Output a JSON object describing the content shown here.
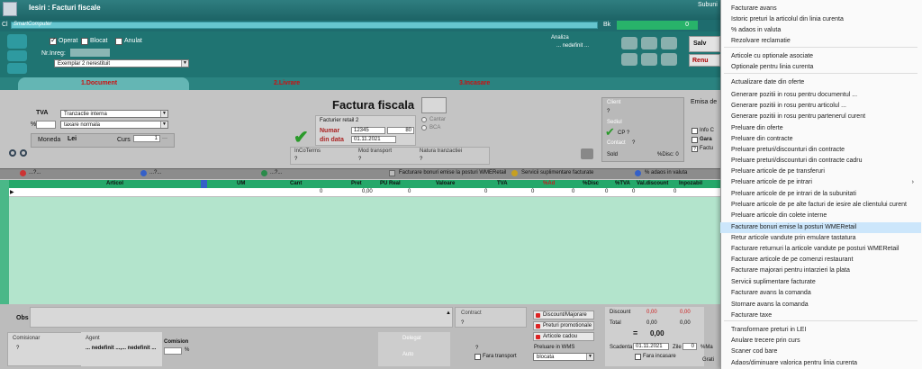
{
  "window": {
    "title": "Iesiri : Facturi fiscale",
    "right_label": "Subuni"
  },
  "top": {
    "client_label": "Cl",
    "client_value": "SmartComputer",
    "bk_label": "Bk",
    "green_value": "0"
  },
  "header": {
    "operat": "Operat",
    "blocat": "Blocat",
    "anulat": "Anulat",
    "nr_inreg_label": "Nr.Inreg:",
    "exemplar": "Exemplar 2 nerestituit",
    "analiza_label": "Analiza",
    "analiza_value": "... nedefinit ...",
    "salveaza": "Salv",
    "renunta": "Renu"
  },
  "tabs": [
    {
      "label": "1.Document"
    },
    {
      "label": "2.Livrare"
    },
    {
      "label": "3.Incasare"
    }
  ],
  "doc": {
    "tva_label": "TVA",
    "tva_value": "Tranzactie interna",
    "tva_pct_label": "%",
    "taxare": "taxare normala",
    "moneda_label": "Moneda",
    "moneda_value": "Lei",
    "curs_label": "Curs",
    "curs_value": "1",
    "factura_title": "Factura fiscala",
    "facturier": "Facturier retail 2",
    "numar_label": "Numar",
    "numar_value": "12345",
    "numar_right": "80",
    "data_label": "din data",
    "data_value": "01.11.2021",
    "cantar": "Cantar",
    "bca": "BCA",
    "incoterms_label": "InCoTerms",
    "incoterms_value": "?",
    "mod_transport_label": "Mod transport",
    "mod_transport_value": "?",
    "natura_label": "Natura tranzactiei",
    "natura_value": "?",
    "client_label": "Client",
    "client_value": "?",
    "sediu_label": "Sediul",
    "sediu_value": "CP ?",
    "contact_label": "Contact",
    "contact_value": "?",
    "sold_label": "Sold",
    "disc_label": "%Disc: 0",
    "emisa_label": "Emisa de",
    "info_label": "Info C",
    "gara_label": "Gara",
    "factu_label": "Factu"
  },
  "iconbar": [
    "...?...",
    "...?...",
    "...?...",
    "Facturare bonuri emise la posturi WMERetail",
    "Servicii suplimentare facturate",
    "% adaos in valuta"
  ],
  "grid": {
    "headers": [
      "Articol",
      "UM",
      "Cant",
      "Pret",
      "PU Real",
      "Valoare",
      "TVA",
      "%Ad",
      "%Disc",
      "%TVA",
      "Val.discount",
      "Inpozabil"
    ],
    "row": {
      "cant": "0",
      "pret": "0,00",
      "pu_real": "0",
      "valoare": "0",
      "tva": "0",
      "ad": "0",
      "disc": "0",
      "tva_pct": "0",
      "valdisc": "0"
    }
  },
  "bottom": {
    "obs_label": "Obs",
    "contract_label": "Contract",
    "contract_value": "?",
    "btn_discount": "Discount/Majorare",
    "btn_preturi": "Preturi promotionale",
    "btn_cadou": "Articole cadou",
    "preluare_label": "Preluare in WMS",
    "preluare_value": "blocata",
    "comisionar_label": "Comisionar",
    "comisionar_value": "?",
    "agent_label": "Agent",
    "agent_value": "... nedefinit ...,... nedefinit ...",
    "comision_label": "Comision",
    "comision_pct": "%",
    "delegat_label": "Delegat",
    "auto_label": "Auto",
    "auto_value": "?",
    "fara_transport": "Fara transport",
    "discount_label": "Discount",
    "total_label": "Total",
    "eq": "=",
    "total_value": "0,00",
    "discount_v1": "0,00",
    "discount_v2": "0,00",
    "total_v1": "0,00",
    "total_v2": "0,00",
    "scadenta_label": "Scadenta",
    "scadenta_value": "01.11.2021",
    "zile_label": "Zile",
    "zile_value": "0",
    "pct_label": "%Ma",
    "fara_incasare": "Fara incasare",
    "gratis": "Grati"
  },
  "menu": [
    "Facturare avans",
    "Istoric preturi la articolul din linia curenta",
    "% adaos in valuta",
    "Rezolvare reclamatie",
    "Articole cu optionale asociate",
    "Optionale pentru linia curenta",
    "Actualizare date din oferte",
    "Generare pozitii in rosu pentru documentul ...",
    "Generare pozitii in rosu pentru articolul ...",
    "Generare pozitii in rosu pentru partenerul curent",
    "Preluare din oferte",
    "Preluare din contracte",
    "Preluare preturi/discounturi din contracte",
    "Preluare preturi/discounturi din contracte cadru",
    "Preluare articole de pe transferuri",
    "Preluare articole de pe intrari",
    "Preluare articole de pe intrari de la subunitati",
    "Preluare articole de pe alte facturi de iesire ale clientului curent",
    "Preluare articole din colete interne",
    "Facturare bonuri emise la posturi  WMERetail",
    "Retur articole vandute prin emulare tastatura",
    "Facturare returnuri la articole vandute pe posturi WMERetail",
    "Facturare articole de pe comenzi restaurant",
    "Facturare majorari pentru intarzieri la plata",
    "Servicii suplimentare facturate",
    "Facturare avans la comanda",
    "Stornare avans la comanda",
    "Facturare taxe",
    "Transformare preturi in LEI",
    "Anulare trecere prin curs",
    "Scaner cod bare",
    "Adaos/diminuare valorica pentru linia curenta"
  ]
}
